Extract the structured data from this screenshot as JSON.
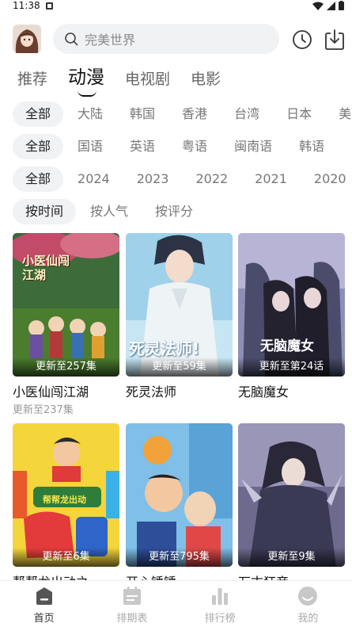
{
  "status": {
    "time": "11:38"
  },
  "search": {
    "placeholder": "完美世界"
  },
  "tabs": [
    {
      "label": "推荐"
    },
    {
      "label": "动漫"
    },
    {
      "label": "电视剧"
    },
    {
      "label": "电影"
    }
  ],
  "filters": {
    "region": [
      "全部",
      "大陆",
      "韩国",
      "香港",
      "台湾",
      "日本",
      "美国"
    ],
    "language": [
      "全部",
      "国语",
      "英语",
      "粤语",
      "闽南语",
      "韩语"
    ],
    "year": [
      "全部",
      "2024",
      "2023",
      "2022",
      "2021",
      "2020"
    ],
    "sort": [
      "按时间",
      "按人气",
      "按评分"
    ]
  },
  "cards": [
    {
      "episode": "更新至257集",
      "title": "小医仙闯江湖",
      "subtitle": "更新至237集",
      "poster_text": "小医仙闯江湖"
    },
    {
      "episode": "更新至59集",
      "title": "死灵法师",
      "subtitle": "",
      "poster_text": "死灵法师!"
    },
    {
      "episode": "更新至第24话",
      "title": "无脑魔女",
      "subtitle": "",
      "poster_text": "无脑魔女"
    },
    {
      "episode": "更新至6集",
      "title": "帮帮龙出动之…",
      "subtitle": "",
      "poster_text": "帮帮龙出动"
    },
    {
      "episode": "更新至795集",
      "title": "开心锤锤",
      "subtitle": "",
      "poster_text": ""
    },
    {
      "episode": "更新至9集",
      "title": "万古狂帝",
      "subtitle": "",
      "poster_text": ""
    }
  ],
  "nav": [
    {
      "label": "首页",
      "icon": "home-icon"
    },
    {
      "label": "排期表",
      "icon": "calendar-icon"
    },
    {
      "label": "排行榜",
      "icon": "ranking-icon"
    },
    {
      "label": "我的",
      "icon": "profile-icon"
    }
  ],
  "colors": {
    "accent": "#222222",
    "chip_bg": "#f1f2f4",
    "inactive": "#aaaaaa"
  }
}
